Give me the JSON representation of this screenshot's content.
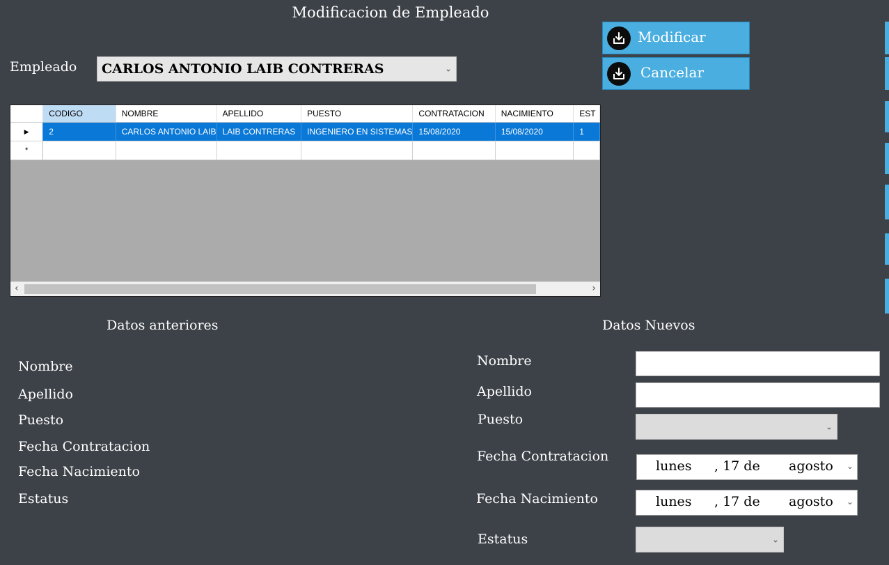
{
  "window": {
    "title": "Modificacion de Empleado"
  },
  "selector": {
    "label": "Empleado",
    "value": "CARLOS ANTONIO LAIB CONTRERAS"
  },
  "buttons": {
    "modify": "Modificar",
    "cancel": "Cancelar"
  },
  "grid": {
    "columns": [
      "CODIGO",
      "NOMBRE",
      "APELLIDO",
      "PUESTO",
      "CONTRATACION",
      "NACIMIENTO",
      "EST"
    ],
    "rows": [
      [
        "2",
        "CARLOS ANTONIO LAIB",
        "LAIB CONTRERAS",
        "INGENIERO EN SISTEMAS",
        "15/08/2020",
        "15/08/2020",
        "1"
      ]
    ],
    "current_row_marker": "▶",
    "new_row_marker": "*"
  },
  "old_data": {
    "heading": "Datos anteriores",
    "fields": [
      "Nombre",
      "Apellido",
      "Puesto",
      "Fecha Contratacion",
      "Fecha Nacimiento",
      "Estatus"
    ]
  },
  "new_data": {
    "heading": "Datos Nuevos",
    "labels": {
      "nombre": "Nombre",
      "apellido": "Apellido",
      "puesto": "Puesto",
      "contratacion": "Fecha Contratacion",
      "nacimiento": "Fecha Nacimiento",
      "estatus": "Estatus"
    },
    "values": {
      "nombre": "",
      "apellido": "",
      "puesto": "",
      "estatus": ""
    },
    "date_contratacion": {
      "weekday": "lunes",
      "day": ", 17 de",
      "month": "agosto"
    },
    "date_nacimiento": {
      "weekday": "lunes",
      "day": ", 17 de",
      "month": "agosto"
    }
  },
  "icons": {
    "dropdown": "chevron-down-icon",
    "button": "download-tray-icon",
    "scroll_left": "scroll-left-icon",
    "scroll_right": "scroll-right-icon"
  },
  "colors": {
    "background": "#3d4148",
    "button": "#4aaee0",
    "selected_row": "#0a78d7",
    "grid_empty": "#ababab"
  }
}
